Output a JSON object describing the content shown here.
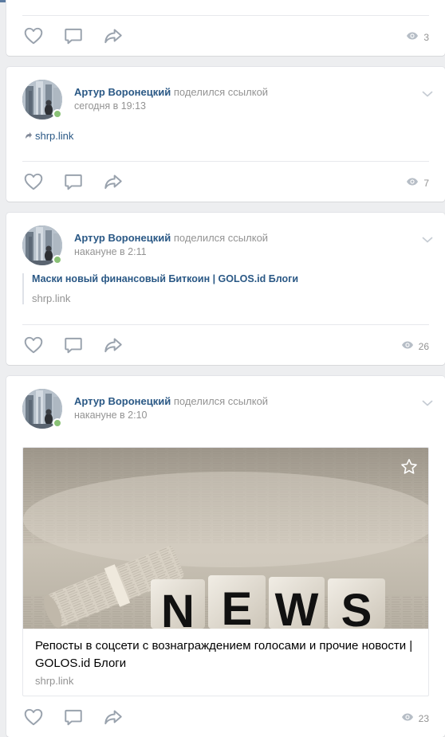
{
  "colors": {
    "link": "#2a5885",
    "muted": "#939393",
    "online": "#8ac176",
    "background": "#edeef0",
    "topbar": "#5b7ba1"
  },
  "icons": {
    "like": "heart-icon",
    "comment": "comment-icon",
    "share": "share-icon",
    "views": "eye-icon",
    "menu": "chevron-down-icon",
    "link": "link-arrow-icon",
    "bookmark": "star-icon"
  },
  "posts": [
    {
      "views": "3"
    },
    {
      "author": "Артур Воронецкий",
      "action": "поделился ссылкой",
      "date": "сегодня в 19:13",
      "link_text": "shrp.link",
      "views": "7"
    },
    {
      "author": "Артур Воронецкий",
      "action": "поделился ссылкой",
      "date": "накануне в 2:11",
      "link_title": "Маски новый финансовый Биткоин | GOLOS.id Блоги",
      "link_host": "shrp.link",
      "views": "26"
    },
    {
      "author": "Артур Воронецкий",
      "action": "поделился ссылкой",
      "date": "накануне в 2:10",
      "snippet_title": "Репосты в соцсети с вознаграждением голосами и прочие новости | GOLOS.id Блоги",
      "snippet_host": "shrp.link",
      "image_letters": [
        "N",
        "E",
        "W",
        "S"
      ],
      "views": "23"
    }
  ]
}
